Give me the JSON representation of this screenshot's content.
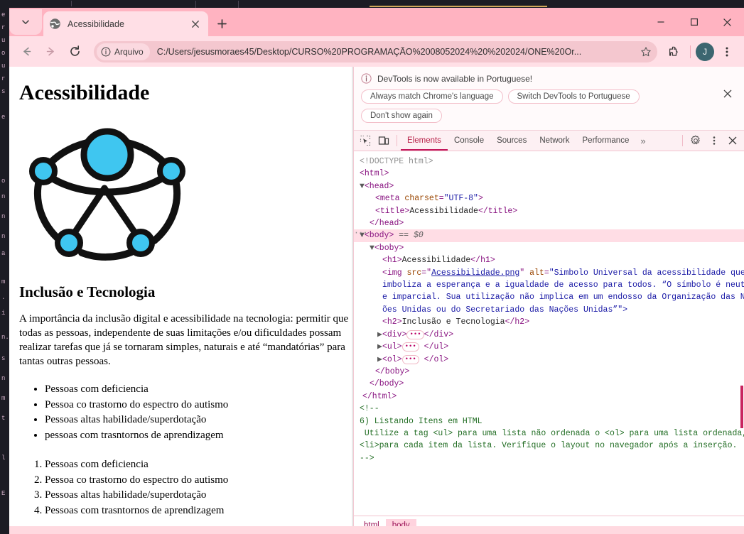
{
  "browser": {
    "tab": {
      "title": "Acessibilidade",
      "favicon_name": "globe-favicon",
      "close_label": "×",
      "new_tab_label": "+"
    },
    "tabstrip_search_name": "tab-search-chevron-icon",
    "window_controls": {
      "minimize": "─",
      "maximize": "□",
      "close": "✕"
    },
    "toolbar": {
      "back": "←",
      "forward": "→",
      "reload": "↻",
      "omnibox_chip": "Arquivo",
      "url": "C:/Users/jesusmoraes45/Desktop/CURSO%20PROGRAMAÇÃO%2008052024%20%202024/ONE%20Or...",
      "star_name": "bookmark-star-icon",
      "extensions_name": "extensions-puzzle-icon",
      "avatar_letter": "J",
      "menu_name": "browser-menu-kebab-icon"
    }
  },
  "page": {
    "h1": "Acessibilidade",
    "image_alt": "Simbolo Universal da acessibilidade que Simboliza a esperança e a igualdade de acesso para todos.",
    "h2": "Inclusão e Tecnologia",
    "paragraph": "A importância da inclusão digital e acessibilidade na tecnologia: permitir que todas as pessoas, independente de suas limitações e/ou dificuldades possam realizar tarefas que já se tornaram simples, naturais e até “mandatórias” para tantas outras pessoas.",
    "unordered_list": [
      "Pessoas com deficiencia",
      "Pessoa co trastorno do espectro do autismo",
      "Pessoas altas habilidade/superdotação",
      "pessoas com trasntornos de aprendizagem"
    ],
    "ordered_list": [
      "Pessoas com deficiencia",
      "Pessoa co trastorno do espectro do autismo",
      "Pessoas altas habilidade/superdotação",
      "Pessoas com trasntornos de aprendizagem"
    ]
  },
  "devtools": {
    "notice": {
      "text": "DevTools is now available in Portuguese!",
      "info_icon_name": "info-circle-icon",
      "buttons": [
        "Always match Chrome's language",
        "Switch DevTools to Portuguese",
        "Don't show again"
      ],
      "close": "✕"
    },
    "toolbar": {
      "inspect_icon_name": "inspect-element-icon",
      "device_icon_name": "device-toolbar-icon",
      "tabs": [
        "Elements",
        "Console",
        "Sources",
        "Network",
        "Performance"
      ],
      "active_tab": "Elements",
      "more_tabs": "»",
      "settings_name": "settings-gear-icon",
      "menu_name": "devtools-kebab-icon",
      "close": "✕"
    },
    "tree": {
      "doctype": "<!DOCTYPE html>",
      "html_open": "<html>",
      "head_open": "<head>",
      "meta_tag": "meta",
      "meta_attr": "charset",
      "meta_val": "\"UTF-8\"",
      "title_tag": "title",
      "title_text": "Acessibilidade",
      "head_close": "</head>",
      "body_open": "<body>",
      "body_selected_marker": "== $0",
      "boby_open": "<boby>",
      "h1_tag": "h1",
      "h1_text": "Acessibilidade",
      "img_tag": "img",
      "img_src_attr": "src",
      "img_src_val": "Acessibilidade.png",
      "img_alt_attr": "alt",
      "img_alt_line1": "\"Simbolo Universal da acessibilidade que S",
      "img_alt_line2": "imboliza a esperança e a igualdade de acesso para todos. “O símbolo é neutro",
      "img_alt_line3": "e imparcial. Sua utilização não implica em um endosso da Organização das Naç",
      "img_alt_line4": "ões Unidas ou do Secretariado das Nações Unidas”\">",
      "h2_tag": "h2",
      "h2_text": "Inclusão e Tecnologia",
      "div_tag": "div",
      "ul_tag": "ul",
      "ol_tag": "ol",
      "boby_close": "</boby>",
      "body_close": "</body>",
      "html_close": "</html>",
      "comment_open": "<!--",
      "comment_line1": "6) Listando Itens em HTML",
      "comment_line2": " Utilize a tag <ul> para uma lista não ordenada o <ol> para uma lista ordenada, e",
      "comment_line3": "<li>para cada item da lista. Verifique o layout no navegador após a inserção.",
      "comment_close": "-->"
    },
    "breadcrumb": {
      "items": [
        "html",
        "body"
      ],
      "active": "body"
    }
  },
  "colors": {
    "browser_frame": "#ffb3c1",
    "toolbar": "#ffdfe6",
    "accent": "#c2185b",
    "avatar": "#3c6670",
    "symbol_cyan": "#3fc6f0",
    "symbol_black": "#111111"
  }
}
